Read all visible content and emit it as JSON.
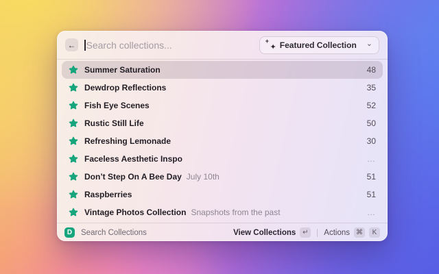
{
  "window": {
    "search": {
      "placeholder": "Search collections...",
      "back_icon": "←"
    },
    "filter": {
      "label": "Featured Collection",
      "icon_star": "✦",
      "icon_plus": "+",
      "chevron": "⌄"
    },
    "rows": [
      {
        "title": "Summer Saturation",
        "subtitle": "",
        "count": "48",
        "selected": true
      },
      {
        "title": "Dewdrop Reflections",
        "subtitle": "",
        "count": "35",
        "selected": false
      },
      {
        "title": "Fish Eye Scenes",
        "subtitle": "",
        "count": "52",
        "selected": false
      },
      {
        "title": "Rustic Still Life",
        "subtitle": "",
        "count": "50",
        "selected": false
      },
      {
        "title": "Refreshing Lemonade",
        "subtitle": "",
        "count": "30",
        "selected": false
      },
      {
        "title": "Faceless Aesthetic Inspo",
        "subtitle": "",
        "count": "…",
        "selected": false
      },
      {
        "title": "Don’t Step On A Bee Day",
        "subtitle": "July 10th",
        "count": "51",
        "selected": false
      },
      {
        "title": "Raspberries",
        "subtitle": "",
        "count": "51",
        "selected": false
      },
      {
        "title": "Vintage Photos Collection",
        "subtitle": "Snapshots from the past",
        "count": "…",
        "selected": false
      }
    ],
    "footer": {
      "logo_letter": "D",
      "app_label": "Search Collections",
      "primary_action": "View Collections",
      "primary_key": "↵",
      "secondary_action": "Actions",
      "secondary_key_1": "⌘",
      "secondary_key_2": "K"
    }
  },
  "colors": {
    "accent_green": "#16a57c",
    "selected_row": "rgba(92,74,92,0.17)",
    "background_corners": [
      "#f8de5c",
      "#6d6fe8",
      "#f69870",
      "#5b5be0"
    ]
  }
}
